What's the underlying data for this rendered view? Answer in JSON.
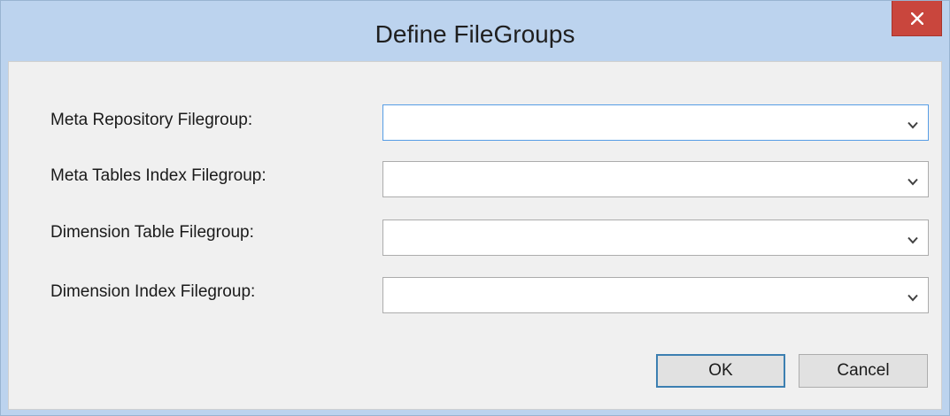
{
  "window": {
    "title": "Define FileGroups",
    "close_icon": "close-icon"
  },
  "fields": [
    {
      "label": "Meta Repository Filegroup:",
      "value": ""
    },
    {
      "label": "Meta Tables Index Filegroup:",
      "value": ""
    },
    {
      "label": "Dimension Table Filegroup:",
      "value": ""
    },
    {
      "label": "Dimension Index Filegroup:",
      "value": ""
    }
  ],
  "buttons": {
    "ok_label": "OK",
    "cancel_label": "Cancel"
  },
  "colors": {
    "frame": "#bcd3ee",
    "close_button": "#c9463d",
    "focus_border": "#569de5",
    "default_button_border": "#3c7fb1"
  }
}
